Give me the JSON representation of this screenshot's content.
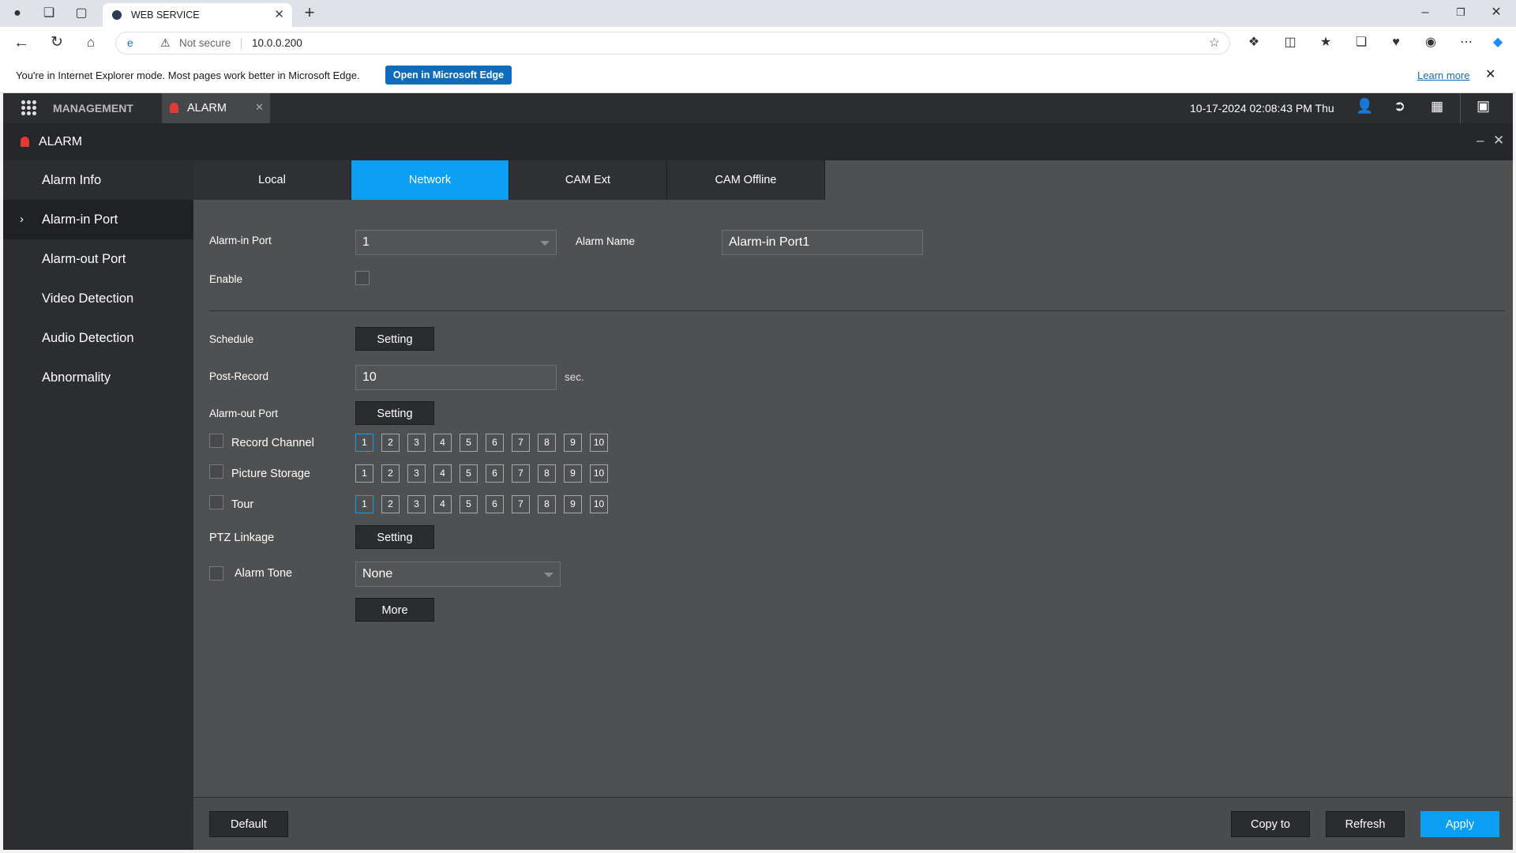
{
  "browser": {
    "tab_title": "WEB SERVICE",
    "security_label": "Not secure",
    "url": "10.0.0.200",
    "ie_notice": "You're in Internet Explorer mode. Most pages work better in Microsoft Edge.",
    "open_edge_label": "Open in Microsoft Edge",
    "learn_more": "Learn more"
  },
  "app": {
    "management_label": "MANAGEMENT",
    "alarm_tab_label": "ALARM",
    "datetime": "10-17-2024 02:08:43 PM Thu",
    "title": "ALARM"
  },
  "sidebar": {
    "items": [
      {
        "label": "Alarm Info"
      },
      {
        "label": "Alarm-in Port"
      },
      {
        "label": "Alarm-out Port"
      },
      {
        "label": "Video Detection"
      },
      {
        "label": "Audio Detection"
      },
      {
        "label": "Abnormality"
      }
    ],
    "active_index": 1
  },
  "tabs": [
    {
      "label": "Local"
    },
    {
      "label": "Network"
    },
    {
      "label": "CAM Ext"
    },
    {
      "label": "CAM Offline"
    }
  ],
  "form": {
    "alarm_in_port_label": "Alarm-in Port",
    "alarm_in_port_value": "1",
    "alarm_name_label": "Alarm Name",
    "alarm_name_value": "Alarm-in Port1",
    "enable_label": "Enable",
    "schedule_label": "Schedule",
    "setting_label": "Setting",
    "post_record_label": "Post-Record",
    "post_record_value": "10",
    "post_record_unit": "sec.",
    "alarm_out_port_label": "Alarm-out Port",
    "record_channel_label": "Record Channel",
    "picture_storage_label": "Picture Storage",
    "tour_label": "Tour",
    "ptz_linkage_label": "PTZ Linkage",
    "alarm_tone_label": "Alarm Tone",
    "alarm_tone_value": "None",
    "more_label": "More",
    "channels": [
      "1",
      "2",
      "3",
      "4",
      "5",
      "6",
      "7",
      "8",
      "9",
      "10"
    ]
  },
  "footer": {
    "default_label": "Default",
    "copy_label": "Copy to",
    "refresh_label": "Refresh",
    "apply_label": "Apply"
  }
}
